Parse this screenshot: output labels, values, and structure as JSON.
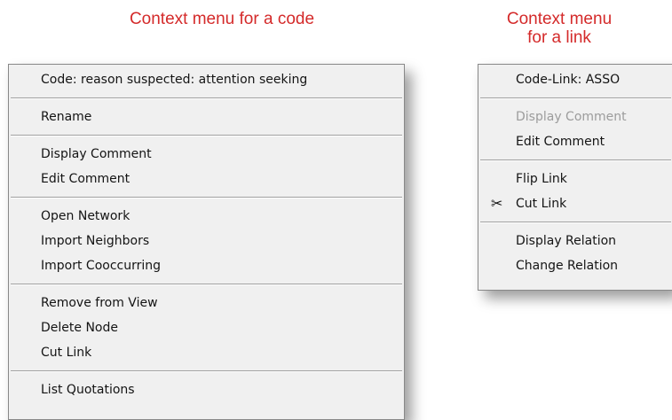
{
  "captions": {
    "code_menu": "Context menu for a code",
    "link_menu_line1": "Context menu",
    "link_menu_line2": "for a link"
  },
  "code_menu": {
    "header": "Code: reason suspected: attention seeking",
    "rename": "Rename",
    "display_comment": "Display Comment",
    "edit_comment": "Edit Comment",
    "open_network": "Open Network",
    "import_neighbors": "Import Neighbors",
    "import_cooccurring": "Import Cooccurring",
    "remove_from_view": "Remove from View",
    "delete_node": "Delete Node",
    "cut_link": "Cut Link",
    "list_quotations": "List Quotations"
  },
  "link_menu": {
    "header": "Code-Link: ASSO",
    "display_comment": "Display Comment",
    "display_comment_enabled": false,
    "edit_comment": "Edit Comment",
    "flip_link": "Flip Link",
    "cut_link": "Cut Link",
    "cut_link_icon": "scissors-icon",
    "display_relation": "Display Relation",
    "change_relation": "Change Relation"
  }
}
